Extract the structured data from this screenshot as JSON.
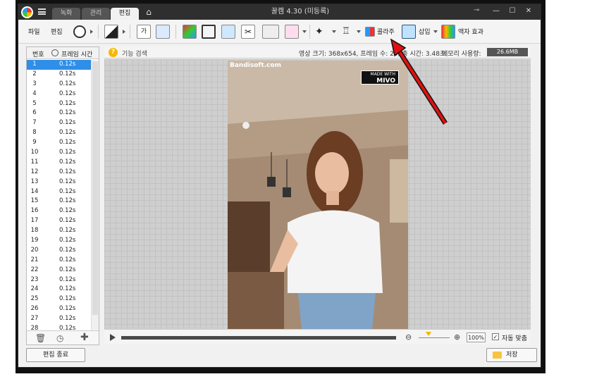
{
  "window": {
    "title": "꿀캠 4.30 (미등록)",
    "tabs": [
      {
        "label": "녹화",
        "active": false
      },
      {
        "label": "관리",
        "active": false
      },
      {
        "label": "편집",
        "active": true
      }
    ]
  },
  "toolbar": {
    "file_label": "파일",
    "edit_label": "편집",
    "collage_label": "콜라주",
    "insert_label": "삽입",
    "frame_effect_label": "액자 효과"
  },
  "frame_list": {
    "col_number": "번호",
    "col_time": "프레임 시간",
    "selected_index": 0,
    "rows": [
      {
        "n": "1",
        "t": "0.12s"
      },
      {
        "n": "2",
        "t": "0.12s"
      },
      {
        "n": "3",
        "t": "0.12s"
      },
      {
        "n": "4",
        "t": "0.12s"
      },
      {
        "n": "5",
        "t": "0.12s"
      },
      {
        "n": "6",
        "t": "0.12s"
      },
      {
        "n": "7",
        "t": "0.12s"
      },
      {
        "n": "8",
        "t": "0.12s"
      },
      {
        "n": "9",
        "t": "0.12s"
      },
      {
        "n": "10",
        "t": "0.12s"
      },
      {
        "n": "11",
        "t": "0.12s"
      },
      {
        "n": "12",
        "t": "0.12s"
      },
      {
        "n": "13",
        "t": "0.12s"
      },
      {
        "n": "14",
        "t": "0.12s"
      },
      {
        "n": "15",
        "t": "0.12s"
      },
      {
        "n": "16",
        "t": "0.12s"
      },
      {
        "n": "17",
        "t": "0.12s"
      },
      {
        "n": "18",
        "t": "0.12s"
      },
      {
        "n": "19",
        "t": "0.12s"
      },
      {
        "n": "20",
        "t": "0.12s"
      },
      {
        "n": "21",
        "t": "0.12s"
      },
      {
        "n": "22",
        "t": "0.12s"
      },
      {
        "n": "23",
        "t": "0.12s"
      },
      {
        "n": "24",
        "t": "0.12s"
      },
      {
        "n": "25",
        "t": "0.12s"
      },
      {
        "n": "26",
        "t": "0.12s"
      },
      {
        "n": "27",
        "t": "0.12s"
      },
      {
        "n": "28",
        "t": "0.12s"
      }
    ]
  },
  "info": {
    "search_label": "기능 검색",
    "summary": "영상 크기: 368x654, 프레임 수: 29, 총 시간: 3.48초",
    "memory_label": "메모리 사용량:",
    "memory_value": "26.6MB"
  },
  "preview": {
    "watermark": "Bandisoft.com",
    "badge_line1": "MADE WITH",
    "badge_line2": "MIVO"
  },
  "timeline": {
    "zoom_level": "100%",
    "fit_label": "자동 맞춤",
    "fit_checked": true
  },
  "buttons": {
    "end_edit": "편집 종료",
    "save": "저장"
  }
}
